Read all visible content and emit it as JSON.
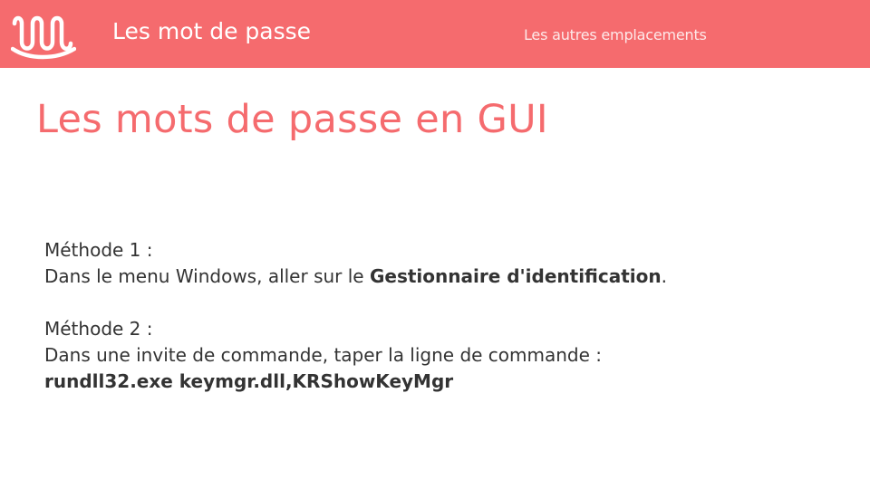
{
  "header": {
    "logo_icon": "wavy-line-logo-icon",
    "section_title": "Les mot de passe",
    "nav_link": "Les autres emplacements",
    "bar_color": "#f56b6e"
  },
  "slide": {
    "title": "Les mots de passe en GUI",
    "title_color": "#f56b6e",
    "method1": {
      "label": "Méthode 1 :",
      "text_before": "Dans le menu Windows, aller sur le ",
      "text_bold": "Gestionnaire d'identification",
      "text_after": "."
    },
    "method2": {
      "label": "Méthode 2 :",
      "text": "Dans une invite de commande, taper la ligne de commande :",
      "command": "rundll32.exe keymgr.dll,KRShowKeyMgr"
    }
  }
}
